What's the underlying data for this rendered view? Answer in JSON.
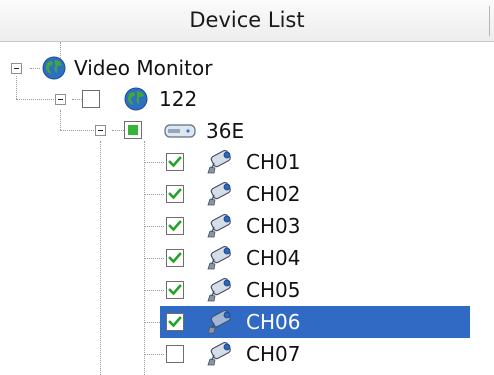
{
  "panel": {
    "title": "Device List"
  },
  "tree": {
    "root": {
      "label": "Video Monitor",
      "icon": "globe-icon",
      "expanded": true
    },
    "group": {
      "label": "122",
      "icon": "globe-icon",
      "checked": false,
      "expanded": true
    },
    "device": {
      "label": "36E",
      "icon": "dvr-device-icon",
      "checked": "partial",
      "expanded": true
    },
    "channels": [
      {
        "label": "CH01",
        "checked": true,
        "selected": false,
        "icon": "camera-icon"
      },
      {
        "label": "CH02",
        "checked": true,
        "selected": false,
        "icon": "camera-icon"
      },
      {
        "label": "CH03",
        "checked": true,
        "selected": false,
        "icon": "camera-icon"
      },
      {
        "label": "CH04",
        "checked": true,
        "selected": false,
        "icon": "camera-icon"
      },
      {
        "label": "CH05",
        "checked": true,
        "selected": false,
        "icon": "camera-icon"
      },
      {
        "label": "CH06",
        "checked": true,
        "selected": true,
        "icon": "camera-icon"
      },
      {
        "label": "CH07",
        "checked": false,
        "selected": false,
        "icon": "camera-icon"
      }
    ]
  },
  "colors": {
    "selection": "#316ac5",
    "check_mark": "#22a322",
    "partial_fill": "#35b535"
  }
}
